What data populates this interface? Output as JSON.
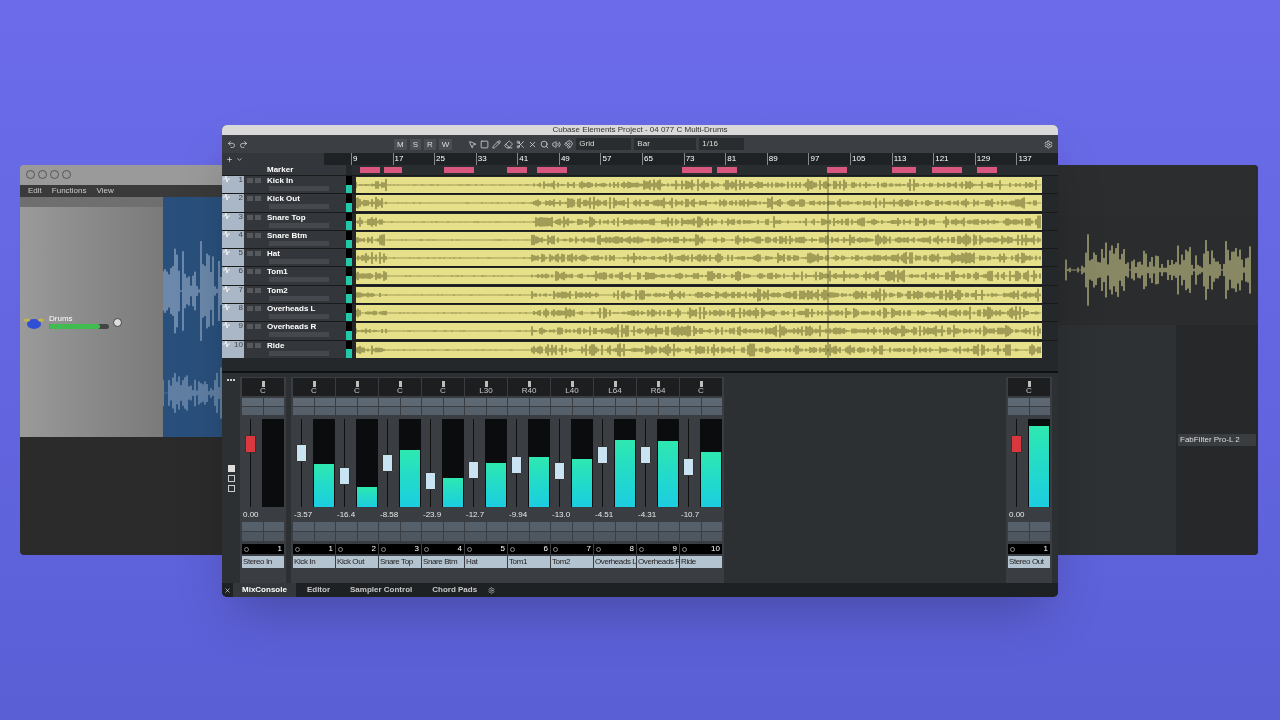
{
  "title": "Cubase Elements Project - 04 077 C Multi-Drums",
  "toolbar": {
    "modes": [
      "M",
      "S",
      "R",
      "W"
    ],
    "snap": "Grid",
    "grid": "Bar",
    "quantize": "1/16"
  },
  "ruler": [
    "9",
    "17",
    "25",
    "33",
    "41",
    "49",
    "57",
    "65",
    "73",
    "81",
    "89",
    "97",
    "105",
    "113",
    "121",
    "129",
    "137"
  ],
  "marker_track": {
    "name": "Marker"
  },
  "tracks": [
    {
      "number": "1",
      "name": "Kick In"
    },
    {
      "number": "2",
      "name": "Kick Out"
    },
    {
      "number": "3",
      "name": "Snare Top"
    },
    {
      "number": "4",
      "name": "Snare Btm"
    },
    {
      "number": "5",
      "name": "Hat"
    },
    {
      "number": "6",
      "name": "Tom1"
    },
    {
      "number": "7",
      "name": "Tom2"
    },
    {
      "number": "8",
      "name": "Overheads L"
    },
    {
      "number": "9",
      "name": "Overheads R"
    },
    {
      "number": "10",
      "name": "Ride"
    }
  ],
  "mixer": {
    "input": {
      "pan": "C",
      "value": "0.00",
      "number": "1",
      "name": "Stereo In",
      "fader": {
        "level": 0.78
      }
    },
    "channels": [
      {
        "pan": "C",
        "value": "-3.57",
        "number": "1",
        "name": "Kick In",
        "fader": {
          "level": 0.65
        },
        "meter": {
          "level": 0.49
        }
      },
      {
        "pan": "C",
        "value": "-16.4",
        "number": "2",
        "name": "Kick Out",
        "fader": {
          "level": 0.34
        },
        "meter": {
          "level": 0.23
        }
      },
      {
        "pan": "C",
        "value": "-8.58",
        "number": "3",
        "name": "Snare Top",
        "fader": {
          "level": 0.52
        },
        "meter": {
          "level": 0.65
        }
      },
      {
        "pan": "C",
        "value": "-23.9",
        "number": "4",
        "name": "Snare Btm",
        "fader": {
          "level": 0.27
        },
        "meter": {
          "level": 0.33
        }
      },
      {
        "pan": "L30",
        "value": "-12.7",
        "number": "5",
        "name": "Hat",
        "fader": {
          "level": 0.42
        },
        "meter": {
          "level": 0.5
        }
      },
      {
        "pan": "R40",
        "value": "-9.94",
        "number": "6",
        "name": "Tom1",
        "fader": {
          "level": 0.48
        },
        "meter": {
          "level": 0.57
        }
      },
      {
        "pan": "L40",
        "value": "-13.0",
        "number": "7",
        "name": "Tom2",
        "fader": {
          "level": 0.4
        },
        "meter": {
          "level": 0.54
        }
      },
      {
        "pan": "L64",
        "value": "-4.51",
        "number": "8",
        "name": "Overheads L",
        "fader": {
          "level": 0.62
        },
        "meter": {
          "level": 0.76
        }
      },
      {
        "pan": "R64",
        "value": "-4.31",
        "number": "9",
        "name": "Overheads R",
        "fader": {
          "level": 0.63
        },
        "meter": {
          "level": 0.75
        }
      },
      {
        "pan": "C",
        "value": "-10.7",
        "number": "10",
        "name": "Ride",
        "fader": {
          "level": 0.46
        },
        "meter": {
          "level": 0.63
        }
      }
    ],
    "output": {
      "pan": "C",
      "value": "0.00",
      "number": "1",
      "name": "Stereo Out",
      "fader": {
        "level": 0.78
      },
      "meter": {
        "level": 0.92
      }
    }
  },
  "tabs": [
    {
      "label": "MixConsole",
      "selected": true
    },
    {
      "label": "Editor",
      "selected": false
    },
    {
      "label": "Sampler Control",
      "selected": false
    },
    {
      "label": "Chord Pads",
      "selected": false
    }
  ],
  "left_window": {
    "menus": [
      "Edit",
      "Functions",
      "View"
    ],
    "track": "Drums",
    "volume": {
      "level": 0.85
    }
  },
  "right_window": {
    "plugin": "FabFilter Pro-L 2"
  }
}
